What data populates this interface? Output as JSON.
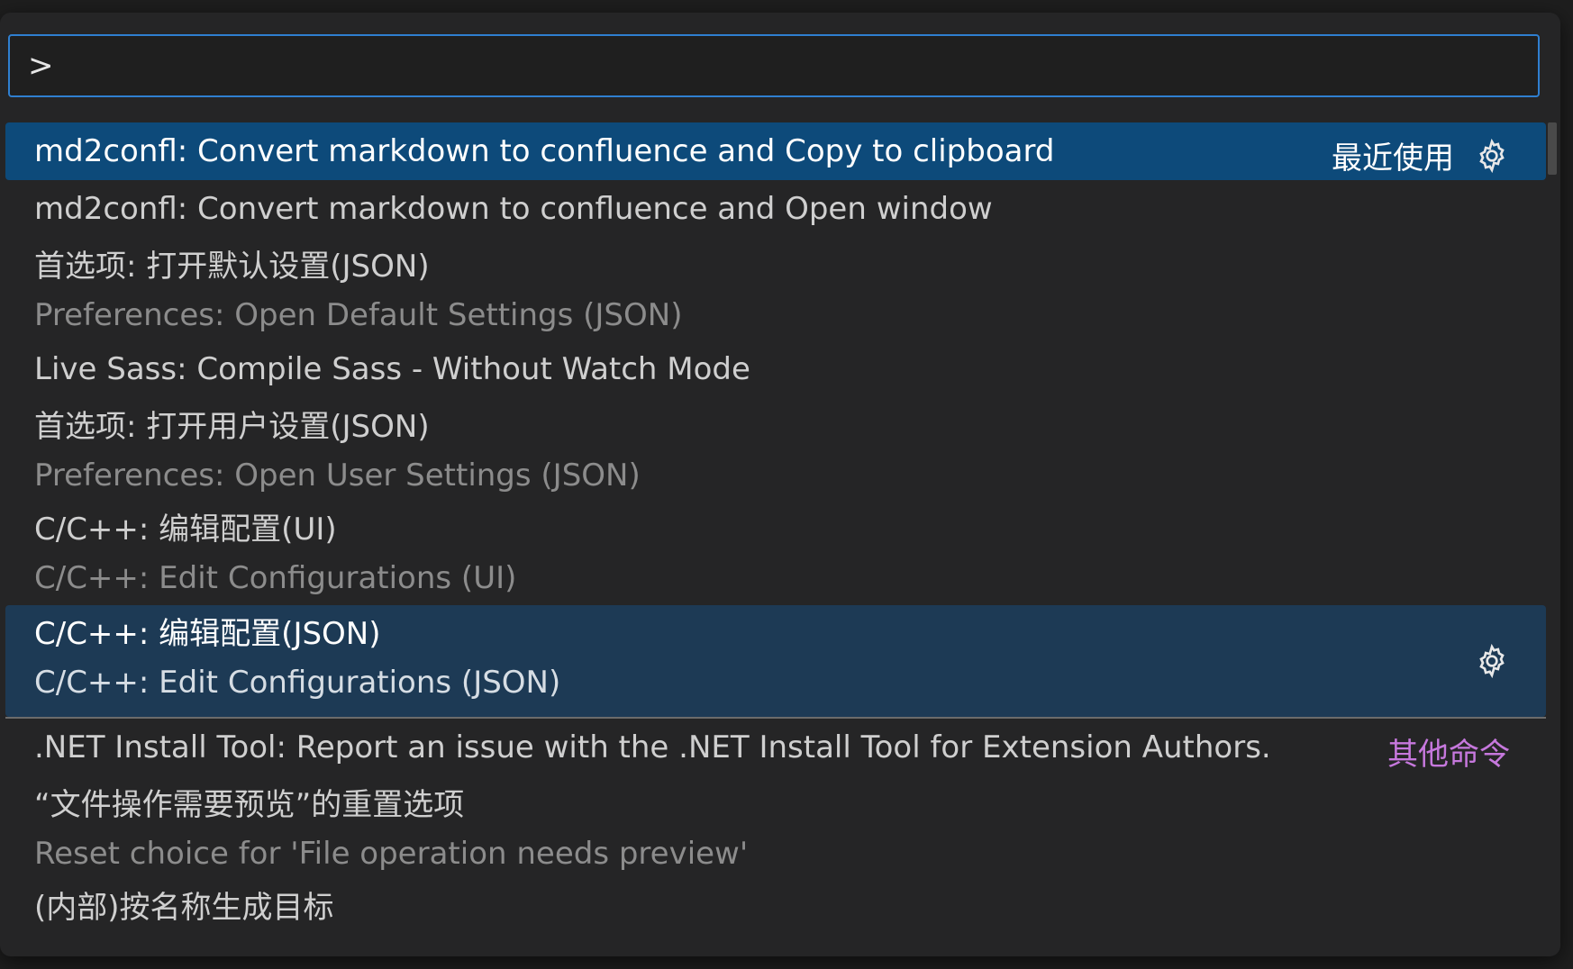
{
  "input": {
    "value": ">"
  },
  "items": [
    {
      "label": "md2confl: Convert markdown to confluence and Copy to clipboard",
      "badge": "最近使用",
      "gear_icon": "gear-icon"
    },
    {
      "label": "md2confl: Convert markdown to confluence and Open window"
    },
    {
      "label": "首选项: 打开默认设置(JSON)",
      "detail": "Preferences: Open Default Settings (JSON)"
    },
    {
      "label": "Live Sass: Compile Sass - Without Watch Mode"
    },
    {
      "label": "首选项: 打开用户设置(JSON)",
      "detail": "Preferences: Open User Settings (JSON)"
    },
    {
      "label": "C/C++: 编辑配置(UI)",
      "detail": "C/C++: Edit Configurations (UI)"
    },
    {
      "label": "C/C++: 编辑配置(JSON)",
      "detail": "C/C++: Edit Configurations (JSON)",
      "gear_icon": "gear-icon"
    },
    {
      "label": ".NET Install Tool: Report an issue with the .NET Install Tool for Extension Authors.",
      "badge": "其他命令"
    },
    {
      "label": "“文件操作需要预览”的重置选项",
      "detail": "Reset choice for 'File operation needs preview'"
    },
    {
      "label": "(内部)按名称生成目标"
    }
  ],
  "colors": {
    "selected_bg": "#0d4a7a",
    "focused_bg": "#1d3a55",
    "input_border": "#2f7fd0",
    "other_commands": "#c678dd"
  }
}
